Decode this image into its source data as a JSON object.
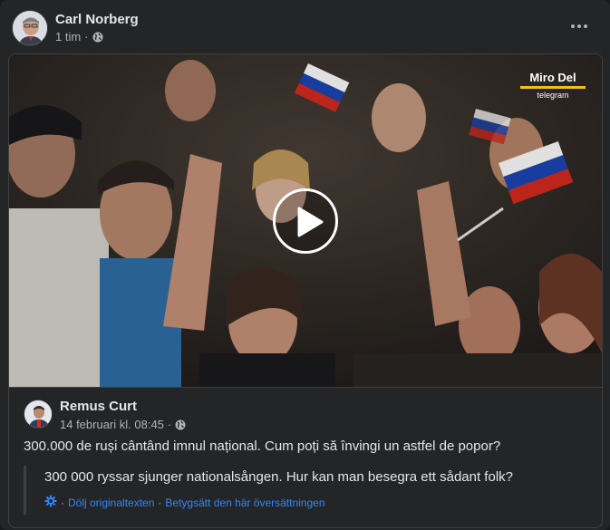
{
  "post": {
    "author": "Carl Norberg",
    "time": "1 tim",
    "meta_separator": "·"
  },
  "shared_post": {
    "watermark": {
      "main": "Miro Del",
      "sub": "telegram"
    },
    "author": "Remus Curt",
    "time": "14 februari kl. 08:45",
    "meta_separator": "·",
    "text": "300.000 de ruși cântând imnul național. Cum poți să învingi un astfel de popor?",
    "translation": {
      "text": "300 000 ryssar sjunger nationalsången. Hur kan man besegra ett sådant folk?",
      "hide_original_label": "Dölj originaltexten",
      "rate_translation_label": "Betygsätt den här översättningen",
      "separator": "·"
    }
  },
  "icons": {
    "globe": "globe-icon",
    "more": "more-horizontal-icon",
    "play": "play-icon",
    "translate": "translate-gear-icon"
  },
  "colors": {
    "background": "#242526",
    "text_primary": "#e4e6eb",
    "text_secondary": "#b0b3b8",
    "link": "#2d88ff"
  }
}
